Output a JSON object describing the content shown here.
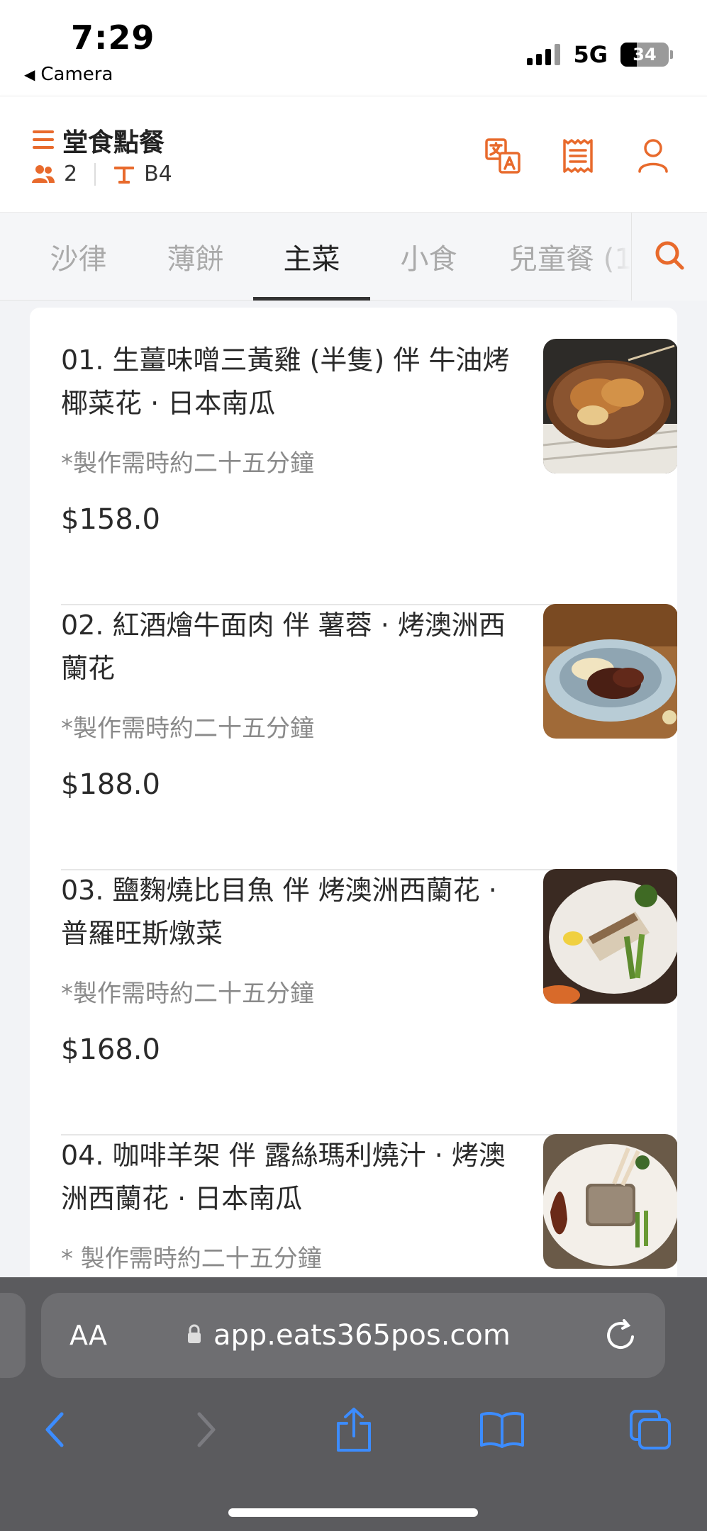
{
  "status_bar": {
    "time": "7:29",
    "back_label": "Camera",
    "network": "5G",
    "battery": "34",
    "battery_level": 0.34
  },
  "header": {
    "title": "堂食點餐",
    "guests": "2",
    "table": "B4",
    "accent_color": "#e86a2c"
  },
  "tabs": [
    "沙律",
    "薄餅",
    "主菜",
    "小食",
    "兒童餐 (1"
  ],
  "active_tab": 2,
  "menu": {
    "items": [
      {
        "name": "01. 生薑味噌三黃雞 (半隻) 伴 牛油烤椰菜花 · 日本南瓜",
        "note": "*製作需時約二十五分鐘",
        "price": "$158.0"
      },
      {
        "name": "02. 紅酒燴牛面肉 伴 薯蓉 · 烤澳洲西蘭花",
        "note": "*製作需時約二十五分鐘",
        "price": "$188.0"
      },
      {
        "name": "03. 鹽麴燒比目魚 伴 烤澳洲西蘭花 · 普羅旺斯燉菜",
        "note": "*製作需時約二十五分鐘",
        "price": "$168.0"
      },
      {
        "name": "04. 咖啡羊架 伴 露絲瑪利燒汁 · 烤澳洲西蘭花 · 日本南瓜",
        "note": "* 製作需時約二十五分鐘",
        "price": ""
      }
    ]
  },
  "browser": {
    "aa_label": "AA",
    "url": "app.eats365pos.com"
  }
}
